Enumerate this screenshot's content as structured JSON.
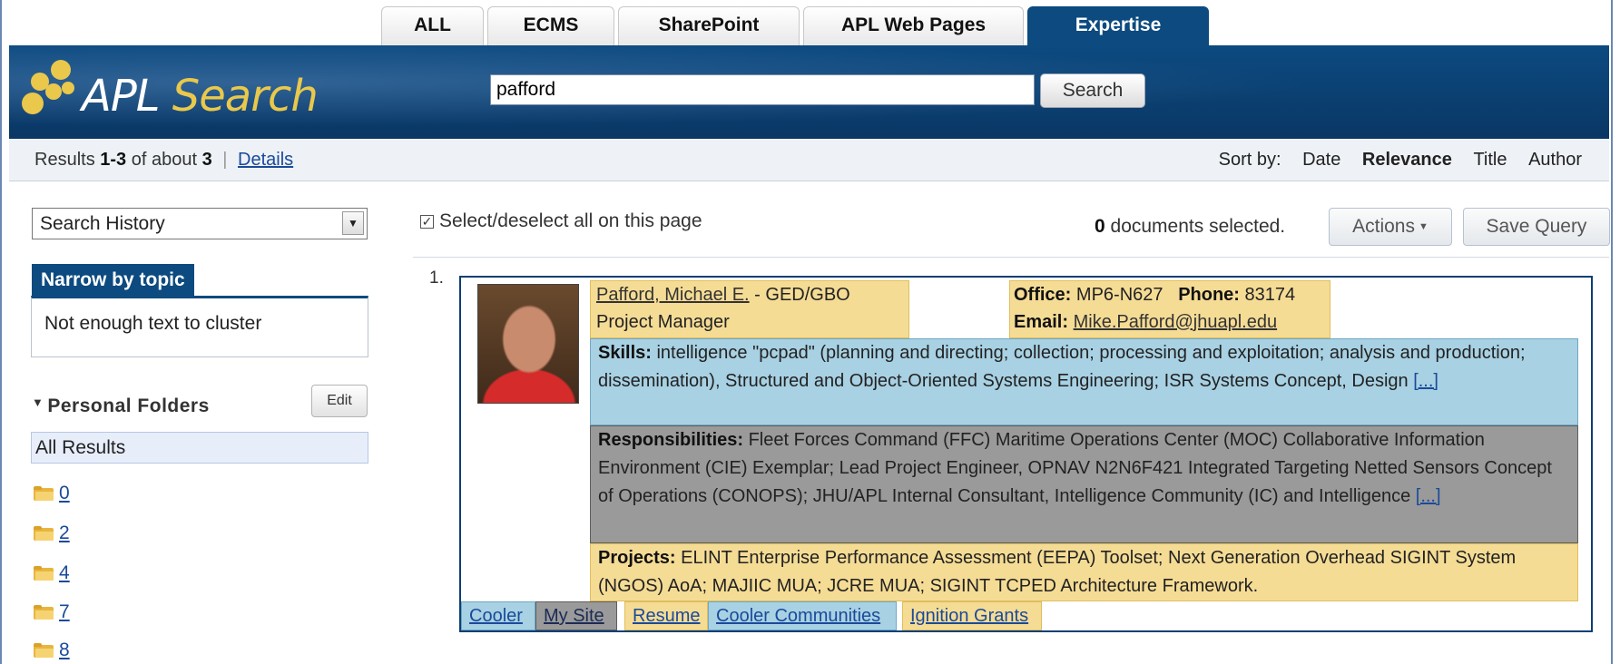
{
  "tabs": [
    {
      "label": "ALL",
      "active": false
    },
    {
      "label": "ECMS",
      "active": false
    },
    {
      "label": "SharePoint",
      "active": false
    },
    {
      "label": "APL Web Pages",
      "active": false
    },
    {
      "label": "Expertise",
      "active": true
    }
  ],
  "logo": {
    "prefix": "APL",
    "accent": "Search"
  },
  "search": {
    "value": "pafford",
    "button_label": "Search"
  },
  "results_bar": {
    "prefix": "Results ",
    "range": "1-3",
    "of_about": " of about ",
    "total": "3",
    "separator": "|",
    "details_link": "Details"
  },
  "sort": {
    "label": "Sort by:",
    "options": [
      "Date",
      "Relevance",
      "Title",
      "Author"
    ],
    "selected": "Relevance"
  },
  "sidebar": {
    "history_select": "Search History",
    "narrow_title": "Narrow by topic",
    "narrow_message": "Not enough text to cluster",
    "personal_folders_title": "Personal Folders",
    "edit_label": "Edit",
    "all_results": "All Results",
    "folders": [
      "0",
      "2",
      "4",
      "7",
      "8"
    ]
  },
  "main": {
    "select_all_label": "Select/deselect all on this page",
    "docs_selected_count": "0",
    "docs_selected_text": " documents selected.",
    "actions_label": "Actions",
    "save_query_label": "Save Query"
  },
  "result": {
    "number": "1.",
    "name": "Pafford, Michael E.",
    "dept": " - GED/GBO",
    "title": "Project Manager",
    "office_label": "Office:",
    "office_value": "MP6-N627",
    "phone_label": "Phone:",
    "phone_value": "83174",
    "email_label": "Email:",
    "email_value": "Mike.Pafford@jhuapl.edu",
    "skills_label": "Skills:",
    "skills_text": " intelligence \"pcpad\" (planning and directing; collection; processing and exploitation; analysis and production; dissemination), Structured and Object-Oriented Systems Engineering; ISR Systems Concept, Design ",
    "skills_more": "[...]",
    "resp_label": "Responsibilities:",
    "resp_text": " Fleet Forces Command (FFC) Maritime Operations Center (MOC) Collaborative Information Environment (CIE) Exemplar; Lead Project Engineer, OPNAV N2N6F421 Integrated Targeting Netted Sensors Concept of Operations (CONOPS); JHU/APL Internal Consultant, Intelligence Community (IC) and Intelligence ",
    "resp_more": "[...]",
    "proj_label": "Projects:",
    "proj_text": " ELINT Enterprise Performance Assessment (EEPA) Toolset; Next Generation Overhead SIGINT System (NGOS) AoA; MAJIIC MUA; JCRE MUA; SIGINT TCPED Architecture Framework.",
    "links": [
      "Cooler",
      "My Site",
      "Resume",
      "Cooler Communities",
      "Ignition Grants"
    ]
  },
  "colors": {
    "brand_blue": "#0c4a7f",
    "highlight_yellow": "#f5dc95",
    "highlight_blue": "#a8d1e3",
    "highlight_gray": "#9a9a9a",
    "link": "#1a4a9a"
  }
}
